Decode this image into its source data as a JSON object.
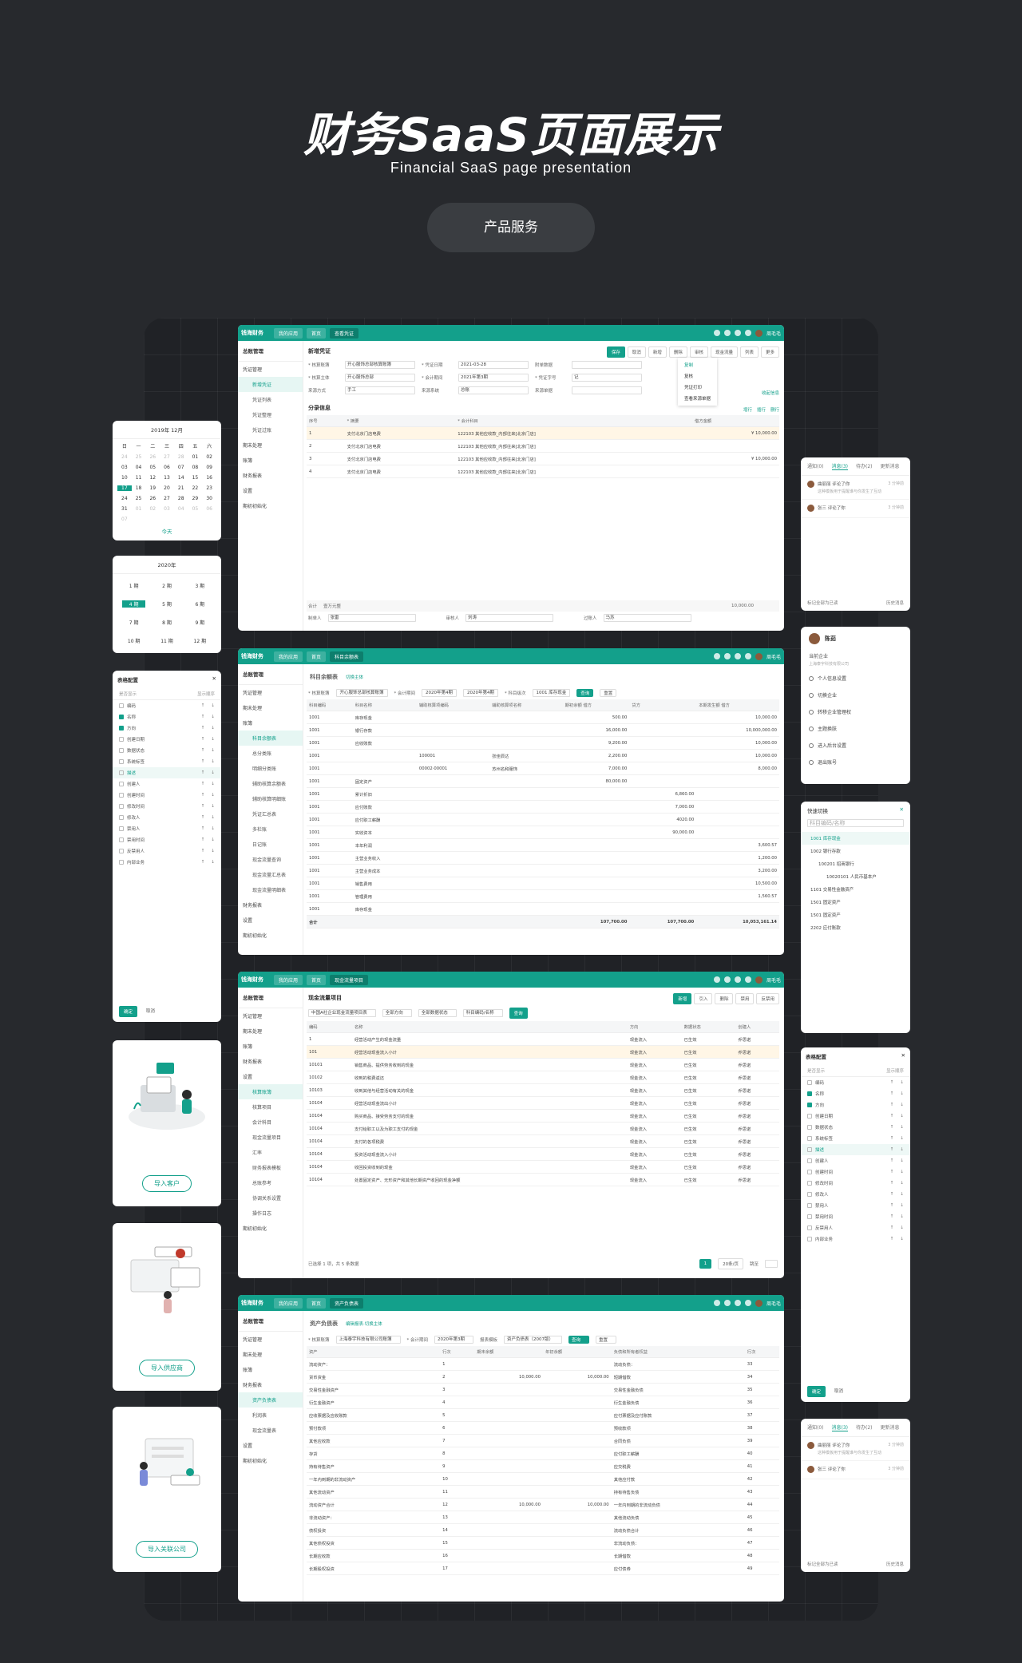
{
  "hero": {
    "title": "财务SaaS页面展示",
    "subtitle": "Financial SaaS page presentation",
    "pill": "产品服务"
  },
  "app": {
    "logo": "钱海财务",
    "user": "周毛毛",
    "nav_home": "我的应用",
    "nav_index": "首页"
  },
  "win1": {
    "tab": "查看凭证",
    "side_title": "总账管理",
    "side": [
      {
        "label": "凭证管理",
        "subs": [
          "新增凭证",
          "凭证列表",
          "凭证整理",
          "凭证过账"
        ]
      },
      {
        "label": "期末处理"
      },
      {
        "label": "账簿"
      },
      {
        "label": "财务报表"
      },
      {
        "label": "设置"
      },
      {
        "label": "期初初始化"
      }
    ],
    "title": "新增凭证",
    "buttons": [
      "保存",
      "取消",
      "新增",
      "删除",
      "审核",
      "现金流量",
      "列表",
      "更多"
    ],
    "menu": [
      "复制",
      "复核",
      "凭证打印",
      "查看来源单据"
    ],
    "form": [
      [
        "* 核算账簿",
        "开心服饰总部核算账簿",
        "* 凭证日期",
        "2021-03-28",
        "附单数据",
        ""
      ],
      [
        "* 核算主体",
        "开心服饰总部",
        "* 会计期间",
        "2021年第3期",
        "* 凭证字号",
        "记"
      ],
      [
        "来源方式",
        "手工",
        "来源系统",
        "总账",
        "来源单据",
        ""
      ]
    ],
    "collapse": "收起信息",
    "section": "分录信息",
    "section_btns": [
      "增行",
      "插行",
      "删行"
    ],
    "head": [
      "序号",
      "* 摘要",
      "* 会计科目",
      "借方金额"
    ],
    "rows": [
      [
        "1",
        "支付北京门店电费",
        "122103 其他应收款_内部往来[北京门店]",
        "¥ 10,000.00"
      ],
      [
        "2",
        "支付北京门店电费",
        "122103 其他应收款_内部往来[北京门店]",
        ""
      ],
      [
        "3",
        "支付北京门店电费",
        "122103 其他应收款_内部往来[北京门店]",
        "¥ 10,000.00"
      ],
      [
        "4",
        "支付北京门店电费",
        "122103 其他应收款_内部往来[北京门店]",
        ""
      ]
    ],
    "total_label": "合计",
    "total_text": "壹万元整",
    "total_value": "10,000.00",
    "footer": [
      "制单人",
      "张雷",
      "审核人",
      "刘涛",
      "过账人",
      "马苏"
    ]
  },
  "win2": {
    "tab": "科目余额表",
    "side_title": "总账管理",
    "side": [
      {
        "label": "凭证管理"
      },
      {
        "label": "期末处理"
      },
      {
        "label": "账簿",
        "subs": [
          "科目余额表",
          "总分类账",
          "明细分类账",
          "辅助核算余额表",
          "辅助核算明细账",
          "凭证汇总表",
          "多栏账",
          "日记账",
          "现金流量查询",
          "现金流量汇总表",
          "现金流量明细表"
        ]
      },
      {
        "label": "财务报表"
      },
      {
        "label": "设置"
      },
      {
        "label": "期初初始化"
      }
    ],
    "title": "科目余额表",
    "subtitle": "切换主体",
    "filters": [
      "* 核算账簿",
      "开心服饰总部核算账簿",
      "* 会计期间",
      "2020年第4期",
      "2020年第4期",
      "* 科目级次",
      "1001 库存现金",
      "查询",
      "重置"
    ],
    "head": [
      "科目编码",
      "科目名称",
      "辅助核算项编码",
      "辅助核算项名称",
      "期初余额 借方",
      "贷方",
      "本期发生额 借方"
    ],
    "rows": [
      [
        "1001",
        "库存现金",
        "",
        "",
        "500.00",
        "",
        "10,000.00"
      ],
      [
        "1001",
        "银行存款",
        "",
        "",
        "16,000.00",
        "",
        "10,000,000.00"
      ],
      [
        "1001",
        "应收账款",
        "",
        "",
        "9,200.00",
        "",
        "10,000.00"
      ],
      [
        "1001",
        "",
        "100001",
        "张佳辰达",
        "2,200.00",
        "",
        "10,000.00"
      ],
      [
        "1001",
        "",
        "00002·00001",
        "苏州名和服饰",
        "7,000.00",
        "",
        "8,000.00"
      ],
      [
        "1001",
        "固定资产",
        "",
        "",
        "80,000.00",
        "",
        ""
      ],
      [
        "1001",
        "累计折旧",
        "",
        "",
        "",
        "6,860.00",
        ""
      ],
      [
        "1001",
        "应付账款",
        "",
        "",
        "",
        "7,000.00",
        ""
      ],
      [
        "1001",
        "应付职工薪酬",
        "",
        "",
        "",
        "4020.00",
        ""
      ],
      [
        "1001",
        "实收资本",
        "",
        "",
        "",
        "90,000.00",
        ""
      ],
      [
        "1001",
        "本年利润",
        "",
        "",
        "",
        "",
        "3,600.57"
      ],
      [
        "1001",
        "主营业务收入",
        "",
        "",
        "",
        "",
        "1,200.00"
      ],
      [
        "1001",
        "主营业务成本",
        "",
        "",
        "",
        "",
        "3,200.00"
      ],
      [
        "1001",
        "销售费用",
        "",
        "",
        "",
        "",
        "10,500.00"
      ],
      [
        "1001",
        "管理费用",
        "",
        "",
        "",
        "",
        "1,560.57"
      ],
      [
        "1001",
        "库存现金",
        "",
        "",
        "",
        "",
        ""
      ]
    ],
    "total": [
      "合计",
      "",
      "",
      "",
      "107,700.00",
      "107,700.00",
      "10,053,161.14"
    ]
  },
  "win3": {
    "tab": "现金流量项目",
    "side_title": "总账管理",
    "side": [
      {
        "label": "凭证管理"
      },
      {
        "label": "期末处理"
      },
      {
        "label": "账簿"
      },
      {
        "label": "财务报表"
      },
      {
        "label": "设置",
        "subs": [
          "核算账簿",
          "核算项目",
          "会计科目",
          "现金流量项目",
          "汇率",
          "财务报表模板",
          "总账参考",
          "协调关系设置",
          "操作日志"
        ]
      },
      {
        "label": "期初初始化"
      }
    ],
    "title": "现金流量项目",
    "buttons": [
      "新增",
      "引入",
      "删除",
      "禁用",
      "反禁用"
    ],
    "filters": [
      "中国A社企业现金流量项目表",
      "全部方向",
      "全部数据状态",
      "科目编码/名称",
      "查询"
    ],
    "head": [
      "编码",
      "名称",
      "方向",
      "数据状态",
      "创建人"
    ],
    "rows": [
      [
        "1",
        "经营活动产生的现金流量",
        "现金流入",
        "已生效",
        "乔思诺"
      ],
      [
        "101",
        "经营活动现金流入小计",
        "现金流入",
        "已生效",
        "乔思诺"
      ],
      [
        "10101",
        "销售商品、提供劳务收到的现金",
        "现金流入",
        "已生效",
        "乔思诺"
      ],
      [
        "10102",
        "收到的税费返还",
        "现金流入",
        "已生效",
        "乔思诺"
      ],
      [
        "10103",
        "收到其他与经营活动有关的现金",
        "现金流入",
        "已生效",
        "乔思诺"
      ],
      [
        "10104",
        "经营活动现金流出小计",
        "现金流入",
        "已生效",
        "乔思诺"
      ],
      [
        "10104",
        "购买商品、接受劳务支付的现金",
        "现金流入",
        "已生效",
        "乔思诺"
      ],
      [
        "10104",
        "支付给职工以及为职工支付的现金",
        "现金流入",
        "已生效",
        "乔思诺"
      ],
      [
        "10104",
        "支付的各项税费",
        "现金流入",
        "已生效",
        "乔思诺"
      ],
      [
        "10104",
        "投资活动现金流入小计",
        "现金流入",
        "已生效",
        "乔思诺"
      ],
      [
        "10104",
        "收回投资收到的现金",
        "现金流入",
        "已生效",
        "乔思诺"
      ],
      [
        "10104",
        "处置固定资产、无形资产和其他长期资产收回的现金净额",
        "现金流入",
        "已生效",
        "乔思诺"
      ]
    ],
    "footer": "已选择 1 项，共 5 条数据",
    "page": "1",
    "page_size": "20条/页",
    "goto": "跳至"
  },
  "win4": {
    "tab": "资产负债表",
    "side_title": "总账管理",
    "side": [
      {
        "label": "凭证管理"
      },
      {
        "label": "期末处理"
      },
      {
        "label": "账簿"
      },
      {
        "label": "财务报表",
        "subs": [
          "资产负债表",
          "利润表",
          "现金流量表"
        ]
      },
      {
        "label": "设置"
      },
      {
        "label": "期初初始化"
      }
    ],
    "title": "资产负债表",
    "subtitle": "编辑报表·切换主体",
    "filters": [
      "* 核算账簿",
      "上海泰宇科技有限公司账簿",
      "* 会计期间",
      "2020年第3期",
      "报表模板",
      "资产负债表（2007版）",
      "查询",
      "重置"
    ],
    "head": [
      "资产",
      "行次",
      "期末余额",
      "年初余额",
      "负债和所有者权益",
      "行次"
    ],
    "rows": [
      [
        "流动资产：",
        "1",
        "",
        "",
        "流动负债：",
        "33"
      ],
      [
        "货币资金",
        "2",
        "10,000.00",
        "10,000.00",
        "短期借款",
        "34"
      ],
      [
        "交易性金融资产",
        "3",
        "",
        "",
        "交易性金融负债",
        "35"
      ],
      [
        "衍生金融资产",
        "4",
        "",
        "",
        "衍生金融负债",
        "36"
      ],
      [
        "应收票据及应收账款",
        "5",
        "",
        "",
        "应付票据及应付账款",
        "37"
      ],
      [
        "预付款项",
        "6",
        "",
        "",
        "预收款项",
        "38"
      ],
      [
        "其他应收款",
        "7",
        "",
        "",
        "合同负债",
        "39"
      ],
      [
        "存货",
        "8",
        "",
        "",
        "应付职工薪酬",
        "40"
      ],
      [
        "持有待售资产",
        "9",
        "",
        "",
        "应交税费",
        "41"
      ],
      [
        "一年内到期的非流动资产",
        "10",
        "",
        "",
        "其他应付款",
        "42"
      ],
      [
        "其他流动资产",
        "11",
        "",
        "",
        "持有待售负债",
        "43"
      ],
      [
        "流动资产合计",
        "12",
        "10,000.00",
        "10,000.00",
        "一年内到期的非流动负债",
        "44"
      ],
      [
        "非流动资产：",
        "13",
        "",
        "",
        "其他流动负债",
        "45"
      ],
      [
        "债权投资",
        "14",
        "",
        "",
        "流动负债合计",
        "46"
      ],
      [
        "其他债权投资",
        "15",
        "",
        "",
        "非流动负债：",
        "47"
      ],
      [
        "长期应收款",
        "16",
        "",
        "",
        "长期借款",
        "48"
      ],
      [
        "长期股权投资",
        "17",
        "",
        "",
        "应付债券",
        "49"
      ]
    ]
  },
  "calendar": {
    "header": "2019年 12月",
    "weekdays": [
      "日",
      "一",
      "二",
      "三",
      "四",
      "五",
      "六"
    ],
    "days": [
      "24",
      "25",
      "26",
      "27",
      "28",
      "01",
      "02",
      "03",
      "04",
      "05",
      "06",
      "07",
      "08",
      "09",
      "10",
      "11",
      "12",
      "13",
      "14",
      "15",
      "16",
      "17",
      "18",
      "19",
      "20",
      "21",
      "22",
      "23",
      "24",
      "25",
      "26",
      "27",
      "28",
      "29",
      "30",
      "31",
      "01",
      "02",
      "03",
      "04",
      "05",
      "06",
      "07"
    ],
    "selected": "17",
    "today": "今天"
  },
  "periods": {
    "header": "2020年",
    "items": [
      "1 期",
      "2 期",
      "3 期",
      "4 期",
      "5 期",
      "6 期",
      "7 期",
      "8 期",
      "9 期",
      "10 期",
      "11 期",
      "12 期"
    ],
    "selected": "4 期"
  },
  "config": {
    "title": "表格配置",
    "col1": "是否显示",
    "col2": "显示顺序",
    "items": [
      "编码",
      "名称",
      "方向",
      "创建日期",
      "数据状态",
      "系统标签",
      "描述",
      "创建人",
      "创建时间",
      "修改时间",
      "修改人",
      "禁用人",
      "禁用时间",
      "反禁用人",
      "内部业务"
    ],
    "ok": "确定",
    "cancel": "取消"
  },
  "import": [
    {
      "button": "导入客户"
    },
    {
      "button": "导入供应商"
    },
    {
      "button": "导入关联公司"
    }
  ],
  "notify": {
    "tabs": [
      "通知(0)",
      "消息(3)",
      "待办(2)",
      "更新消息"
    ],
    "items": [
      {
        "text": "曲丽丽 评论了你",
        "desc": "这种模板用于提醒谁与你发生了互动",
        "time": "3 分钟前"
      },
      {
        "text": "张三 评论了你",
        "desc": "",
        "time": "3 分钟前"
      }
    ],
    "clear": "标记全部为已读",
    "more": "历史消息"
  },
  "profile": {
    "name": "陈茹",
    "company_label": "当前企业",
    "company": "上海泰宇科技有限公司",
    "items": [
      "个人信息设置",
      "切换企业",
      "转移企业管理权",
      "主题换肤",
      "进入后台设置",
      "退出账号"
    ]
  },
  "tree": {
    "title": "快速切换",
    "placeholder": "科目编码/名称",
    "items": [
      "1001 库存现金",
      "1002 银行存款",
      "100201 招商银行",
      "10020101 人民币基本户",
      "1101 交易性金融资产",
      "1501 固定资产",
      "1501 固定资产",
      "2202 应付账款"
    ]
  }
}
